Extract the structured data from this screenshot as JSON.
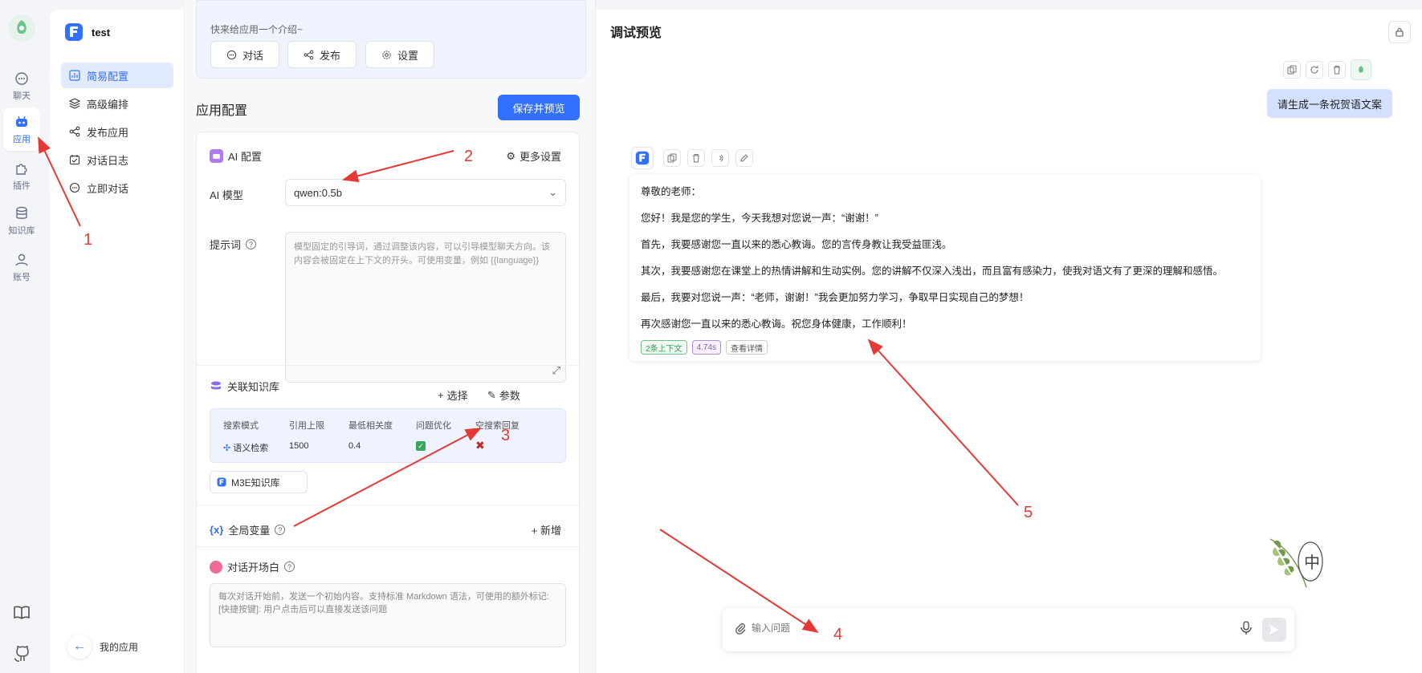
{
  "rail": {
    "items": [
      {
        "label": "聊天",
        "icon": "chat-icon"
      },
      {
        "label": "应用",
        "icon": "robot-icon"
      },
      {
        "label": "插件",
        "icon": "puzzle-icon"
      },
      {
        "label": "知识库",
        "icon": "database-icon"
      },
      {
        "label": "账号",
        "icon": "user-icon"
      }
    ],
    "bottom_icons": [
      "book-icon",
      "github-icon"
    ]
  },
  "nav": {
    "app_name": "test",
    "items": [
      {
        "label": "简易配置"
      },
      {
        "label": "高级编排"
      },
      {
        "label": "发布应用"
      },
      {
        "label": "对话日志"
      },
      {
        "label": "立即对话"
      }
    ],
    "footer_label": "我的应用"
  },
  "intro": {
    "text": "快来给应用一个介绍~",
    "buttons": {
      "chat": "对话",
      "publish": "发布",
      "settings": "设置"
    }
  },
  "config": {
    "title": "应用配置",
    "save_label": "保存并预览",
    "ai_section": "AI 配置",
    "more_settings": "更多设置",
    "model_label": "AI 模型",
    "model_value": "qwen:0.5b",
    "prompt_label": "提示词",
    "prompt_placeholder": "模型固定的引导词，通过调整该内容，可以引导模型聊天方向。该内容会被固定在上下文的开头。可使用变量，例如 {{language}}",
    "kb_section": "关联知识库",
    "kb_select": "选择",
    "kb_params": "参数",
    "kb_table": {
      "headers": [
        "搜索模式",
        "引用上限",
        "最低相关度",
        "问题优化",
        "空搜索回复"
      ],
      "row": {
        "mode": "语义检索",
        "limit": "1500",
        "min_score": "0.4"
      }
    },
    "kb_tag": "M3E知识库",
    "vars_section": "全局变量",
    "vars_add": "新增",
    "opening_section": "对话开场白",
    "opening_placeholder": "每次对话开始前，发送一个初始内容。支持标准 Markdown 语法，可使用的额外标记: [快捷按键]: 用户点击后可以直接发送该问题"
  },
  "preview": {
    "title": "调试预览",
    "user_message": "请生成一条祝贺语文案",
    "bot_lines": [
      "尊敬的老师：",
      "您好！我是您的学生，今天我想对您说一声：“谢谢！”",
      "首先，我要感谢您一直以来的悉心教诲。您的言传身教让我受益匪浅。",
      "其次，我要感谢您在课堂上的热情讲解和生动实例。您的讲解不仅深入浅出，而且富有感染力，使我对语文有了更深的理解和感悟。",
      "最后，我要对您说一声：“老师，谢谢！”我会更加努力学习，争取早日实现自己的梦想！",
      "再次感谢您一直以来的悉心教诲。祝您身体健康，工作顺利！"
    ],
    "tags": {
      "context": "2条上下文",
      "time": "4.74s",
      "details": "查看详情"
    },
    "input_placeholder": "输入问题"
  },
  "annotations": [
    "1",
    "2",
    "3",
    "4",
    "5"
  ],
  "colors": {
    "accent": "#3370ff",
    "annotation": "#e53935",
    "user_bubble": "#d3e1ff"
  }
}
